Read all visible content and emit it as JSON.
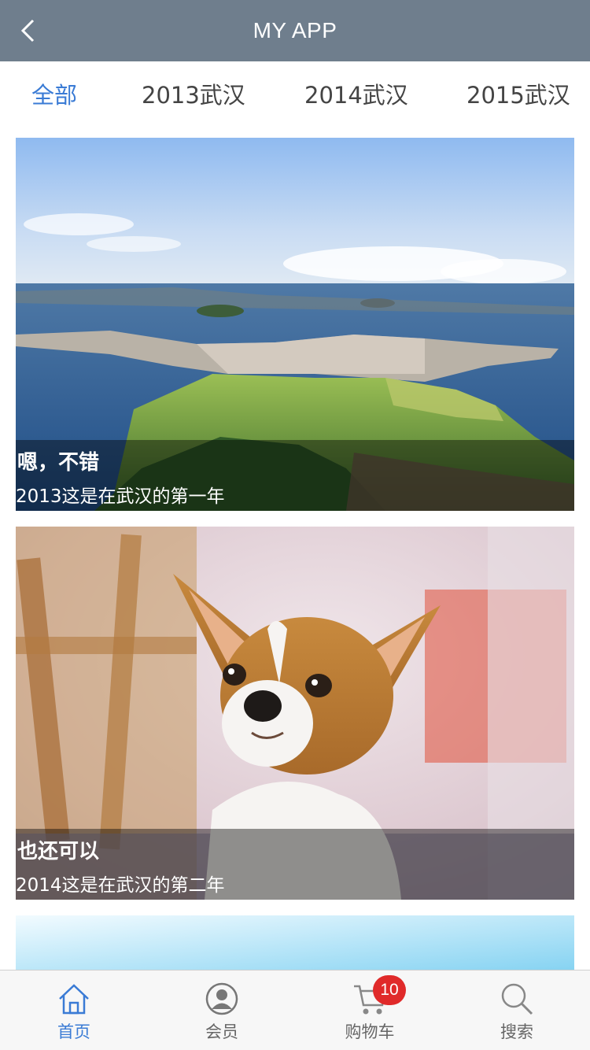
{
  "header": {
    "title": "MY APP"
  },
  "tabs": [
    {
      "label": "全部",
      "active": true
    },
    {
      "label": "2013武汉",
      "active": false
    },
    {
      "label": "2014武汉",
      "active": false
    },
    {
      "label": "2015武汉",
      "active": false
    }
  ],
  "cards": [
    {
      "title": "嗯，不错",
      "subtitle": "2013这是在武汉的第一年",
      "image": "coastal-town-aerial-photo"
    },
    {
      "title": "也还可以",
      "subtitle": "2014这是在武汉的第二年",
      "image": "chihuahua-dog-photo"
    }
  ],
  "bottom_nav": [
    {
      "label": "首页",
      "icon": "home-icon",
      "active": true
    },
    {
      "label": "会员",
      "icon": "user-icon",
      "active": false
    },
    {
      "label": "购物车",
      "icon": "cart-icon",
      "active": false,
      "badge": "10"
    },
    {
      "label": "搜索",
      "icon": "search-icon",
      "active": false
    }
  ],
  "colors": {
    "header_bg": "#6f7e8d",
    "accent": "#3a7bd5",
    "badge": "#e02a2a"
  }
}
